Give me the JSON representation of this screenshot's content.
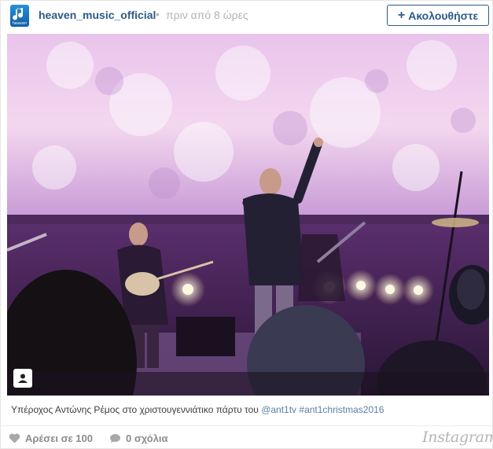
{
  "header": {
    "username": "heaven_music_official",
    "separator": "•",
    "time_ago": "πριν από 8 ώρες",
    "follow_label": "Ακολουθήστε",
    "follow_plus": "+",
    "avatar_text": "heaven"
  },
  "caption": {
    "text": "Υπέροχος Αντώνης Ρέμος στο χριστουγεννιάτικο πάρτυ του ",
    "mention": "@ant1tv",
    "hashtag": " #ant1christmas2016"
  },
  "footer": {
    "likes_label": "Αρέσει σε 100",
    "comments_label": "0 σχόλια",
    "brand": "Instagram"
  },
  "icons": {
    "avatar": "heaven-logo-icon",
    "user_tag": "user-tag-icon",
    "like": "heart-icon",
    "comment": "comment-bubble-icon"
  },
  "colors": {
    "username": "#2d5a87",
    "link": "#5a7ea6",
    "muted": "#8c8c8c"
  }
}
